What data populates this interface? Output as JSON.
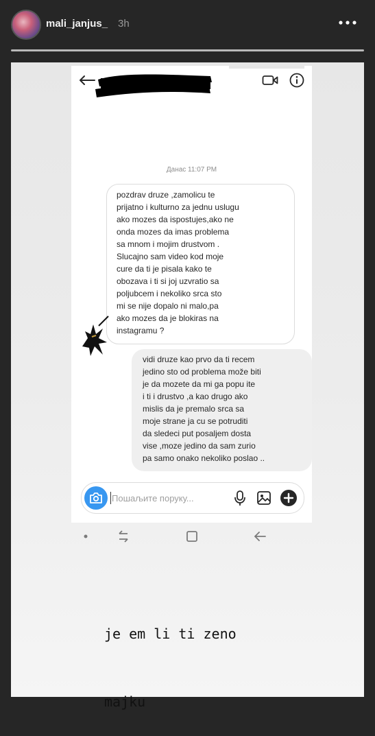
{
  "header": {
    "username": "mali_janjus_",
    "time": "3h"
  },
  "dm": {
    "date_separator": "Данас 11:07 PM",
    "messages": [
      {
        "direction": "received",
        "text": "pozdrav druze ,zamolicu te\nprijatno i kulturno za jednu uslugu\nako mozes da ispostujes,ako ne\nonda mozes da imas problema\nsa mnom i mojim drustvom .\nSlucajno sam video kod moje\ncure da ti je pisala kako te\nobozava i ti si joj uzvratio sa\npoljubcem i nekoliko srca sto\nmi se nije dopalo ni malo,pa\nako mozes da je blokiras na\ninstagramu ?"
      },
      {
        "direction": "sent",
        "text": "vidi druze kao prvo da ti recem\njedino sto od problema može biti\nje da mozete da mi ga popu  ite\ni ti i drustvo ,a kao drugo ako\nmislis da je premalo srca sa\nmoje strane ja cu se potruditi\nda sledeci put posaljem dosta\nvise ,moze jedino da sam zurio\npa samo onako nekoliko poslao .."
      }
    ],
    "composer": {
      "placeholder": "Пошаљите поруку..."
    }
  },
  "caption": {
    "line1": "je em li ti zeno",
    "line2": "majku"
  },
  "colors": {
    "background": "#262626",
    "accent_blue": "#3897f0"
  },
  "icons": [
    "more-icon",
    "back-icon",
    "video-call-icon",
    "info-icon",
    "camera-icon",
    "microphone-icon",
    "gallery-icon",
    "plus-icon"
  ]
}
